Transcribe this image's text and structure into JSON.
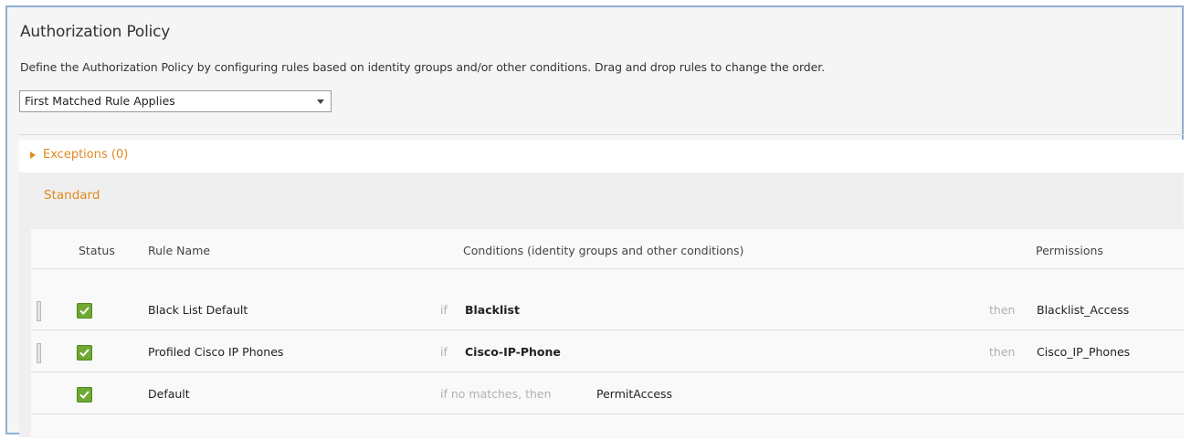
{
  "header": {
    "title": "Authorization Policy",
    "description": "Define the Authorization Policy by configuring rules based on identity groups and/or other conditions. Drag and drop rules to change the order."
  },
  "policy_select": {
    "value": "First Matched Rule Applies"
  },
  "exceptions": {
    "label": "Exceptions (0)"
  },
  "standard": {
    "label": "Standard",
    "columns": {
      "status": "Status",
      "rule_name": "Rule Name",
      "conditions": "Conditions (identity groups and other conditions)",
      "permissions": "Permissions"
    },
    "rules": [
      {
        "name": "Black List Default",
        "if_label": "if",
        "condition": "Blacklist",
        "then_label": "then",
        "permission": "Blacklist_Access",
        "enabled": true
      },
      {
        "name": "Profiled Cisco IP Phones",
        "if_label": "if",
        "condition": "Cisco-IP-Phone",
        "then_label": "then",
        "permission": "Cisco_IP_Phones",
        "enabled": true
      }
    ],
    "default_rule": {
      "name": "Default",
      "if_label": "if no matches, then",
      "permission": "PermitAccess",
      "enabled": true
    }
  },
  "colors": {
    "accent_orange": "#e0891f",
    "status_green": "#6fa832",
    "frame_border": "#8fb0cf"
  }
}
